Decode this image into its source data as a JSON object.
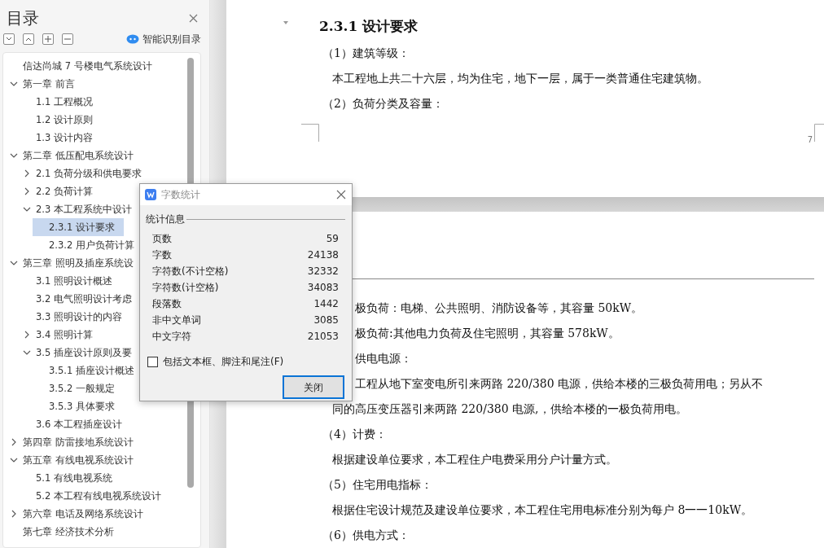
{
  "sidebar": {
    "title": "目录",
    "smart_button": "智能识别目录",
    "tree": [
      {
        "label": "信达尚城 7 号楼电气系统设计",
        "selected": false
      },
      {
        "label": "第一章  前言",
        "selected": false,
        "expanded": true,
        "children": [
          {
            "label": "1.1  工程概况",
            "selected": false
          },
          {
            "label": "1.2 设计原则",
            "selected": false
          },
          {
            "label": "1.3 设计内容",
            "selected": false
          }
        ]
      },
      {
        "label": "第二章  低压配电系统设计",
        "selected": false,
        "expanded": true,
        "children": [
          {
            "label": "2.1 负荷分级和供电要求",
            "selected": false,
            "expanded": false
          },
          {
            "label": "2.2  负荷计算",
            "selected": false,
            "expanded": false
          },
          {
            "label": "2.3 本工程系统中设计",
            "selected": false,
            "expanded": true,
            "children": [
              {
                "label": "2.3.1  设计要求",
                "selected": true
              },
              {
                "label": "2.3.2 用户负荷计算",
                "selected": false
              }
            ]
          }
        ]
      },
      {
        "label": "第三章  照明及插座系统设",
        "selected": false,
        "expanded": true,
        "children": [
          {
            "label": "3.1  照明设计概述",
            "selected": false
          },
          {
            "label": "3.2  电气照明设计考虑",
            "selected": false
          },
          {
            "label": "3.3  照明设计的内容",
            "selected": false
          },
          {
            "label": "3.4  照明计算",
            "selected": false,
            "expanded": false
          },
          {
            "label": "3.5  插座设计原则及要",
            "selected": false,
            "expanded": true,
            "children": [
              {
                "label": "3.5.1  插座设计概述",
                "selected": false
              },
              {
                "label": "3.5.2 一般规定",
                "selected": false
              },
              {
                "label": "3.5.3 具体要求",
                "selected": false
              }
            ]
          },
          {
            "label": "3.6 本工程插座设计",
            "selected": false
          }
        ]
      },
      {
        "label": "第四章  防雷接地系统设计",
        "selected": false,
        "expanded": false
      },
      {
        "label": "第五章  有线电视系统设计",
        "selected": false,
        "expanded": true,
        "children": [
          {
            "label": "5.1 有线电视系统",
            "selected": false
          },
          {
            "label": "5.2 本工程有线电视系统设计",
            "selected": false
          }
        ]
      },
      {
        "label": "第六章  电话及网络系统设计",
        "selected": false,
        "expanded": false
      },
      {
        "label": "第七章  经济技术分析",
        "selected": false
      }
    ]
  },
  "document": {
    "page_number": "7",
    "page1": [
      {
        "kind": "heading",
        "text": "2.3.1  设计要求"
      },
      {
        "kind": "item",
        "text": "（1）建筑等级："
      },
      {
        "kind": "body",
        "text": "本工程地上共二十六层，均为住宅，地下一层，属于一类普通住宅建筑物。"
      },
      {
        "kind": "item",
        "text": "（2）负荷分类及容量："
      }
    ],
    "page2": [
      {
        "kind": "cut",
        "text": "极负荷：电梯、公共照明、消防设备等，其容量 50kW。"
      },
      {
        "kind": "cut",
        "text": "极负荷:其他电力负荷及住宅照明，其容量 578kW。"
      },
      {
        "kind": "cut",
        "text": "供电电源："
      },
      {
        "kind": "cut",
        "text": "工程从地下室变电所引来两路 220/380 电源，供给本楼的三极负荷用电；另从不"
      },
      {
        "kind": "body",
        "text": "同的高压变压器引来两路 220/380 电源,，供给本楼的一极负荷用电。"
      },
      {
        "kind": "item",
        "text": "（4）计费："
      },
      {
        "kind": "body",
        "text": "根据建设单位要求，本工程住户电费采用分户计量方式。"
      },
      {
        "kind": "item",
        "text": "（5）住宅用电指标："
      },
      {
        "kind": "body",
        "text": "根据住宅设计规范及建设单位要求，本工程住宅用电标准分别为每户 8一一10kW。"
      },
      {
        "kind": "item",
        "text": "（6）供电方式："
      }
    ]
  },
  "dialog": {
    "title": "字数统计",
    "group_label": "统计信息",
    "stats": [
      {
        "label": "页数",
        "value": "59"
      },
      {
        "label": "字数",
        "value": "24138"
      },
      {
        "label": "字符数(不计空格)",
        "value": "32332"
      },
      {
        "label": "字符数(计空格)",
        "value": "34083"
      },
      {
        "label": "段落数",
        "value": "1442"
      },
      {
        "label": "非中文单词",
        "value": "3085"
      },
      {
        "label": "中文字符",
        "value": "21053"
      }
    ],
    "checkbox": {
      "label": "包括文本框、脚注和尾注(F)",
      "checked": false
    },
    "close_button": "关闭"
  }
}
